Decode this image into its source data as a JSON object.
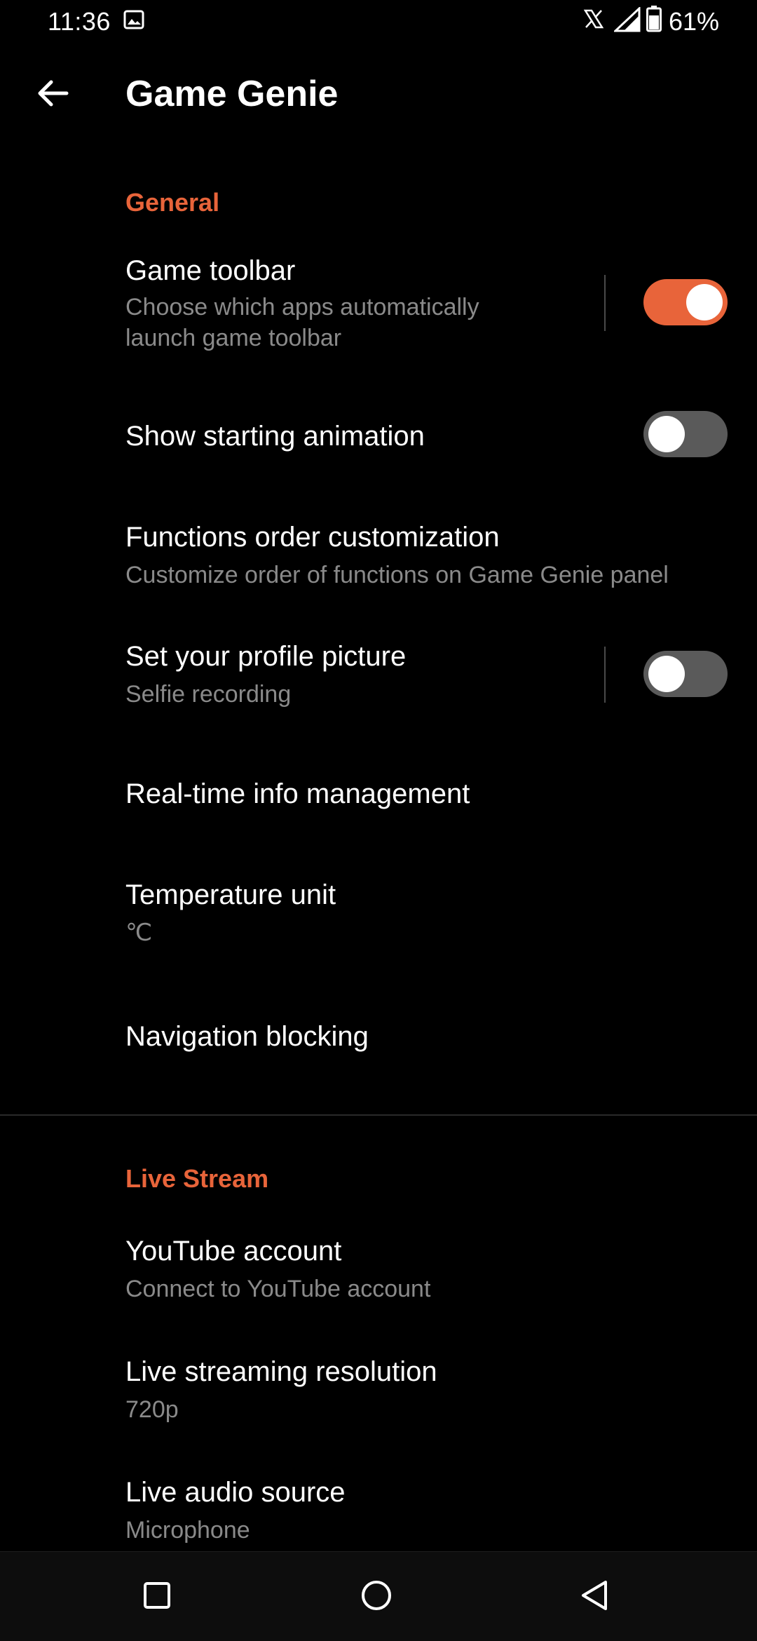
{
  "status_bar": {
    "time": "11:36",
    "battery": "61%",
    "icons": [
      "image-icon",
      "x-app-icon",
      "signal-icon",
      "battery-icon"
    ]
  },
  "app_bar": {
    "title": "Game Genie",
    "back_icon": "arrow-left-icon"
  },
  "accent_color": "#e8643a",
  "general": {
    "header": "General",
    "game_toolbar": {
      "title": "Game toolbar",
      "subtitle_line1": "Choose which apps automatically",
      "subtitle_line2": "launch game toolbar",
      "enabled": true
    },
    "show_starting_animation": {
      "title": "Show starting animation",
      "enabled": false
    },
    "functions_order": {
      "title": "Functions order customization",
      "subtitle": "Customize order of functions on Game Genie panel"
    },
    "profile_picture": {
      "title": "Set your profile picture",
      "subtitle": "Selfie recording",
      "enabled": false
    },
    "realtime_info": {
      "title": "Real-time info management"
    },
    "temperature_unit": {
      "title": "Temperature unit",
      "value": "℃"
    },
    "navigation_blocking": {
      "title": "Navigation blocking"
    }
  },
  "live_stream": {
    "header": "Live Stream",
    "youtube_account": {
      "title": "YouTube account",
      "subtitle": "Connect to YouTube account"
    },
    "resolution": {
      "title": "Live streaming resolution",
      "value": "720p"
    },
    "audio_source": {
      "title": "Live audio source",
      "value": "Microphone"
    }
  },
  "nav_bar": {
    "icons": [
      "recents-icon",
      "home-icon",
      "back-triangle-icon"
    ]
  }
}
